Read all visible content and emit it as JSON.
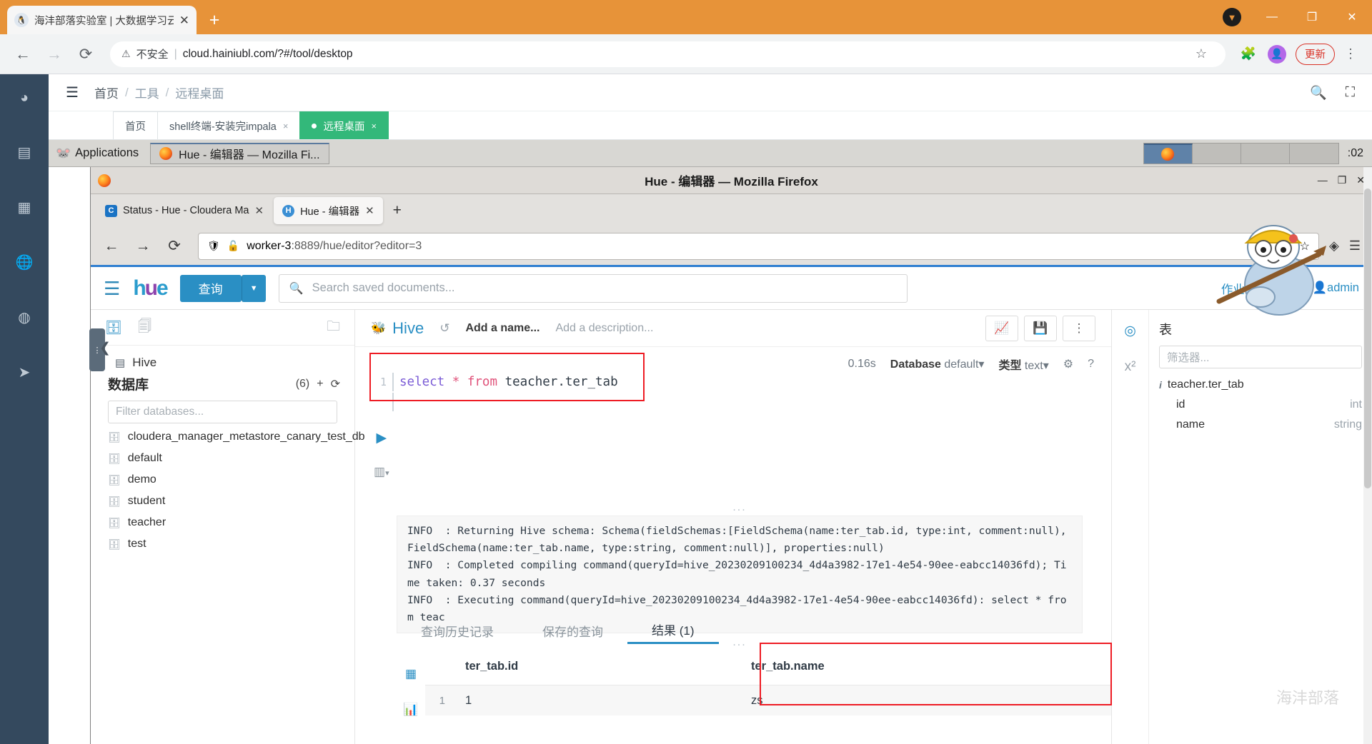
{
  "chrome": {
    "tab": {
      "title": "海沣部落实验室 | 大数据学习云环",
      "favicon_icon": "site-favicon",
      "close_icon": "✕"
    },
    "newtab_icon": "+",
    "window_controls": {
      "pin_icon": "▼",
      "minimize_icon": "—",
      "maximize_icon": "❐",
      "close_icon": "✕"
    },
    "toolbar": {
      "back_icon": "←",
      "forward_icon": "→",
      "reload_icon": "⟳",
      "warning_icon": "⚠",
      "security_label": "不安全",
      "divider": "|",
      "url": "cloud.hainiubl.com/?#/tool/desktop",
      "bookmark_icon": "☆",
      "extensions_icon": "🧩",
      "profile_icon": "👤",
      "update_label": "更新",
      "menu_icon": "⋮"
    }
  },
  "app": {
    "rail_icons": [
      "dashboard-icon",
      "document-icon",
      "apps-grid-icon",
      "globe-icon",
      "target-icon",
      "send-icon"
    ],
    "header": {
      "menu_icon": "☰",
      "breadcrumb": [
        "首页",
        "工具",
        "远程桌面"
      ],
      "separator": "/",
      "search_icon": "🔍",
      "fullscreen_icon": "⛶"
    },
    "tabs": [
      {
        "label": "首页",
        "closable": false,
        "active": false
      },
      {
        "label": "shell终端-安装完impala",
        "closable": true,
        "active": false,
        "close_icon": "×"
      },
      {
        "label": "远程桌面",
        "closable": true,
        "active": true,
        "close_icon": "×",
        "dot": "●"
      }
    ]
  },
  "desktop": {
    "panel": {
      "applications_label": "Applications",
      "applications_icon": "mouse-icon",
      "window_button": "Hue - 编辑器 — Mozilla Fi...",
      "workspaces": 4,
      "active_workspace": 1,
      "clock": ":02"
    }
  },
  "firefox": {
    "title": "Hue - 编辑器 — Mozilla Firefox",
    "window_controls": {
      "minimize_icon": "—",
      "restore_icon": "❐",
      "close_icon": "✕"
    },
    "tabs": [
      {
        "label": "Status - Hue - Cloudera Ma",
        "favicon_letter": "C",
        "favicon_color": "#1a73c4",
        "active": false,
        "close_icon": "✕"
      },
      {
        "label": "Hue - 编辑器",
        "favicon_letter": "H",
        "favicon_color": "#3b8fd4",
        "active": true,
        "close_icon": "✕"
      }
    ],
    "newtab_icon": "+",
    "nav": {
      "back_icon": "←",
      "forward_icon": "→",
      "reload_icon": "⟳"
    },
    "urlbar": {
      "shield_icon": "🛡",
      "lock_broken_icon": "🔓",
      "url_host": "worker-3",
      "url_rest": ":8889/hue/editor?editor=3",
      "star_icon": "☆"
    },
    "right_icons": {
      "pocket_icon": "◈",
      "menu_icon": "☰"
    }
  },
  "hue": {
    "nav": {
      "burger_icon": "☰",
      "logo_text": "hue",
      "query_button": "查询",
      "query_caret_icon": "▼",
      "search_icon": "🔍",
      "search_placeholder": "Search saved documents...",
      "jobs_label": "作业",
      "jobs_icon": "list-icon",
      "history_icon": "↺",
      "user_icon": "user-icon",
      "user_label": "admin"
    },
    "assist": {
      "db_icon": "database-icon",
      "docs_icon": "documents-icon",
      "open_folder_icon": "folder-open-icon",
      "source_label": "Hive",
      "source_icon": "hive-server-icon",
      "databases_label": "数据库",
      "databases_count": "(6)",
      "add_icon": "+",
      "refresh_icon": "⟳",
      "filter_placeholder": "Filter databases...",
      "databases": [
        "cloudera_manager_metastore_canary_test_db",
        "default",
        "demo",
        "student",
        "teacher",
        "test"
      ]
    },
    "editor": {
      "engine": "Hive",
      "engine_icon": "hive-icon",
      "history_icon": "↺",
      "name_placeholder": "Add a name...",
      "description_placeholder": "Add a description...",
      "chart_button_icon": "chart-icon",
      "save_button_icon": "save-icon",
      "more_button_icon": "⋮",
      "meta": {
        "duration": "0.16s",
        "database_label": "Database",
        "database_value": "default",
        "database_caret": "▾",
        "type_label": "类型",
        "type_value": "text",
        "type_caret": "▾",
        "settings_icon": "gear-icon",
        "help_icon": "?"
      },
      "code": {
        "line_number": "1",
        "keyword1": "select",
        "star": "*",
        "keyword2": "from",
        "table": "teacher.ter_tab"
      },
      "run_icon": "▶",
      "book_icon": "book-icon",
      "book_caret": "▾"
    },
    "logs": {
      "dots": "...",
      "lines": [
        "INFO  : Returning Hive schema: Schema(fieldSchemas:[FieldSchema(name:ter_tab.id, type:int, comment:null), FieldSchema(name:ter_tab.name, type:string, comment:null)], properties:null)",
        "INFO  : Completed compiling command(queryId=hive_20230209100234_4d4a3982-17e1-4e54-90ee-eabcc14036fd); Time taken: 0.37 seconds",
        "INFO  : Executing command(queryId=hive_20230209100234_4d4a3982-17e1-4e54-90ee-eabcc14036fd): select * from teac"
      ],
      "dots_bottom": "..."
    },
    "result_tabs": [
      {
        "label": "查询历史记录",
        "active": false
      },
      {
        "label": "保存的查询",
        "active": false
      },
      {
        "label": "结果 (1)",
        "active": true
      }
    ],
    "result_grid": {
      "rail_icons": [
        "grid-icon",
        "chart-small-icon"
      ],
      "columns": [
        "ter_tab.id",
        "ter_tab.name"
      ],
      "rows": [
        {
          "index": "1",
          "cells": [
            "1",
            "zs"
          ]
        }
      ]
    },
    "right_assist": {
      "rail_icons": [
        "compass-icon",
        "x-squared-icon"
      ],
      "title": "表",
      "filter_placeholder": "筛选器...",
      "info_icon": "i",
      "table_name": "teacher.ter_tab",
      "columns": [
        {
          "name": "id",
          "type": "int"
        },
        {
          "name": "name",
          "type": "string"
        }
      ]
    },
    "watermark": "海沣部落"
  },
  "colors": {
    "chrome_accent": "#e79339",
    "app_rail": "#34495e",
    "tab_green": "#33b87a",
    "hue_blue": "#2a8fc4",
    "highlight_red": "#ee1c24"
  }
}
